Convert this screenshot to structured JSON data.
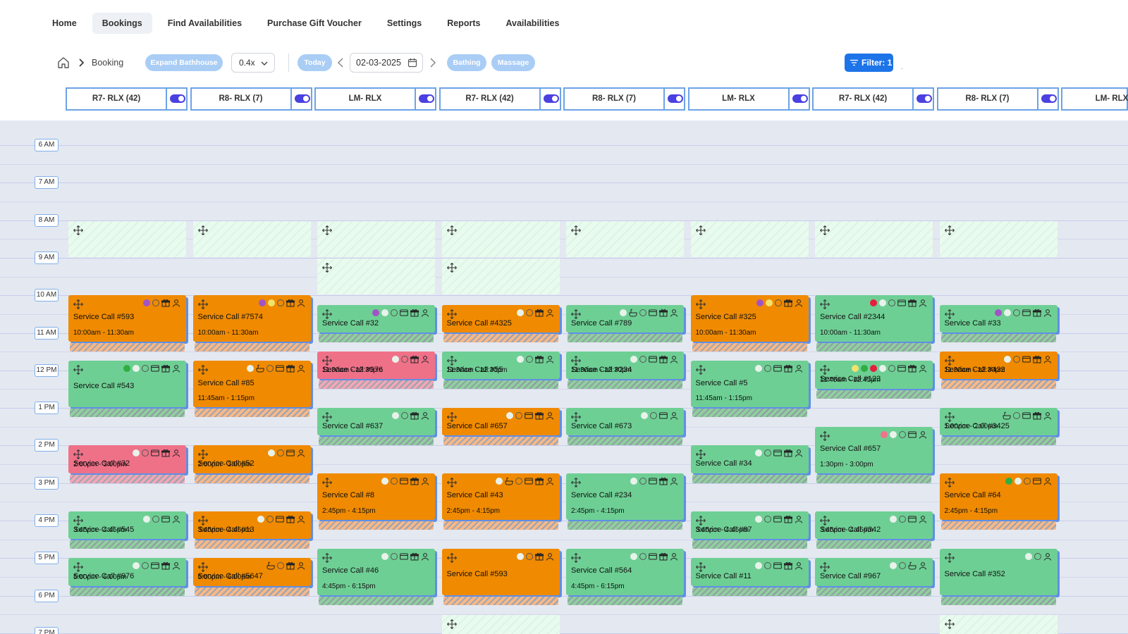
{
  "nav": {
    "items": [
      {
        "label": "Home",
        "active": false
      },
      {
        "label": "Bookings",
        "active": true
      },
      {
        "label": "Find Availabilities",
        "active": false
      },
      {
        "label": "Purchase Gift Voucher",
        "active": false
      },
      {
        "label": "Settings",
        "active": false
      },
      {
        "label": "Reports",
        "active": false
      },
      {
        "label": "Availabilities",
        "active": false
      }
    ]
  },
  "toolbar": {
    "breadcrumb_label": "Booking",
    "expand_label": "Expand Bathhouse",
    "zoom_value": "0.4x",
    "today_label": "Today",
    "date_value": "02-03-2025",
    "bathing_label": "Bathing",
    "massage_label": "Massage",
    "filter_label": "Filter: 1",
    "dot_mark": "."
  },
  "columns": [
    {
      "title": "R7- RLX (42)"
    },
    {
      "title": "R8- RLX (7)"
    },
    {
      "title": "LM- RLX"
    },
    {
      "title": "R7- RLX (42)"
    },
    {
      "title": "R8- RLX (7)"
    },
    {
      "title": "LM- RLX"
    },
    {
      "title": "R7- RLX (42)"
    },
    {
      "title": "R8- RLX (7)"
    },
    {
      "title": "LM- RLX"
    }
  ],
  "time_labels": [
    "6 AM",
    "7 AM",
    "8 AM",
    "9 AM",
    "10 AM",
    "11 AM",
    "12 PM",
    "1 PM",
    "2 PM",
    "3 PM",
    "4 PM",
    "5 PM",
    "6 PM",
    "7 PM"
  ],
  "colors": {
    "orange": "#f08a00",
    "green": "#6ecf94",
    "pink": "#ef7188",
    "accent": "#1d74e8"
  },
  "open_slots": [
    {
      "col": 0,
      "start": 8,
      "end": 9
    },
    {
      "col": 1,
      "start": 8,
      "end": 9
    },
    {
      "col": 2,
      "start": 8,
      "end": 9
    },
    {
      "col": 2,
      "start": 9,
      "end": 10
    },
    {
      "col": 3,
      "start": 8,
      "end": 9
    },
    {
      "col": 3,
      "start": 9,
      "end": 10
    },
    {
      "col": 4,
      "start": 8,
      "end": 9
    },
    {
      "col": 5,
      "start": 8,
      "end": 9
    },
    {
      "col": 6,
      "start": 8,
      "end": 9
    },
    {
      "col": 7,
      "start": 8,
      "end": 9
    },
    {
      "col": 3,
      "start": 18.5,
      "end": 19.5
    },
    {
      "col": 7,
      "start": 18.5,
      "end": 19.5
    }
  ],
  "bookings": [
    {
      "col": 0,
      "start": 10,
      "end": 11.5,
      "color": "orange",
      "title": "Service Call #593",
      "time": "10:00am - 11:30am",
      "icons": [
        "dot-purple",
        "ring",
        "gift",
        "user"
      ]
    },
    {
      "col": 0,
      "start": 11.75,
      "end": 13.25,
      "color": "green",
      "title": "Service Call #543",
      "time": "",
      "icons": [
        "dot-green",
        "dot-white",
        "ring",
        "card",
        "gift",
        "user"
      ]
    },
    {
      "col": 0,
      "start": 14,
      "end": 15,
      "color": "pink",
      "title": "Service Call #32",
      "time": "2:00pm - 3:00pm",
      "icons": [
        "dot-white",
        "ring",
        "card",
        "gift",
        "user"
      ]
    },
    {
      "col": 0,
      "start": 15.75,
      "end": 16.75,
      "color": "green",
      "title": "Service Call #545",
      "time": "3:45pm - 4:45pm",
      "icons": [
        "dot-white",
        "ring",
        "card",
        "user"
      ]
    },
    {
      "col": 0,
      "start": 17,
      "end": 18,
      "color": "green",
      "title": "Service Call #976",
      "time": "5:00pm - 6:00pm",
      "icons": [
        "dot-white",
        "ring",
        "card",
        "gift",
        "user"
      ]
    },
    {
      "col": 1,
      "start": 10,
      "end": 11.5,
      "color": "orange",
      "title": "Service Call #7574",
      "time": "10:00am - 11:30am",
      "icons": [
        "dot-purple",
        "dot-yellow",
        "ring",
        "gift",
        "user"
      ]
    },
    {
      "col": 1,
      "start": 11.75,
      "end": 13.25,
      "color": "orange",
      "title": "Service Call #85",
      "time": "11:45am - 1:15pm",
      "icons": [
        "dot-white",
        "bath",
        "ring",
        "card",
        "gift",
        "user"
      ]
    },
    {
      "col": 1,
      "start": 14,
      "end": 15,
      "color": "orange",
      "title": "Service Call #52",
      "time": "2:00pm - 3:00pm",
      "icons": [
        "dot-white",
        "ring",
        "card",
        "user"
      ]
    },
    {
      "col": 1,
      "start": 15.75,
      "end": 16.75,
      "color": "orange",
      "title": "Service Call #13",
      "time": "3:45pm - 4:45pm",
      "icons": [
        "dot-white",
        "ring",
        "card",
        "gift",
        "user"
      ]
    },
    {
      "col": 1,
      "start": 17,
      "end": 18,
      "color": "orange",
      "title": "Service Call #5647",
      "time": "5:00pm - 6:00pm",
      "icons": [
        "bath",
        "ring",
        "gift",
        "user"
      ]
    },
    {
      "col": 2,
      "start": 10.25,
      "end": 11.25,
      "color": "green",
      "title": "Service Call #32",
      "time": "",
      "icons": [
        "dot-purple",
        "dot-white",
        "ring",
        "card",
        "gift",
        "user"
      ]
    },
    {
      "col": 2,
      "start": 11.5,
      "end": 12.5,
      "color": "pink",
      "title": "Service Call #976",
      "time": "11:30am - 12:30pm",
      "icons": [
        "dot-white",
        "ring",
        "gift",
        "user"
      ]
    },
    {
      "col": 2,
      "start": 13,
      "end": 14,
      "color": "green",
      "title": "Service Call #637",
      "time": "",
      "icons": [
        "dot-white",
        "ring",
        "gift",
        "user"
      ]
    },
    {
      "col": 2,
      "start": 14.75,
      "end": 16.25,
      "color": "orange",
      "title": "Service Call #8",
      "time": "2:45pm - 4:15pm",
      "icons": [
        "dot-white",
        "ring",
        "card",
        "gift",
        "user"
      ]
    },
    {
      "col": 2,
      "start": 16.75,
      "end": 18.25,
      "color": "green",
      "title": "Service Call #46",
      "time": "4:45pm - 6:15pm",
      "icons": [
        "dot-white",
        "ring",
        "card",
        "gift",
        "user"
      ]
    },
    {
      "col": 3,
      "start": 10.25,
      "end": 11.25,
      "color": "orange",
      "title": "Service Call #4325",
      "time": "",
      "icons": [
        "dot-white",
        "ring",
        "gift",
        "user"
      ]
    },
    {
      "col": 3,
      "start": 11.5,
      "end": 12.5,
      "color": "green",
      "title": "Service Call #55",
      "time": "11:30am - 12:30pm",
      "icons": [
        "dot-white",
        "ring",
        "gift",
        "user"
      ]
    },
    {
      "col": 3,
      "start": 13,
      "end": 14,
      "color": "orange",
      "title": "Service Call #657",
      "time": "",
      "icons": [
        "dot-white",
        "ring",
        "card",
        "gift",
        "user"
      ]
    },
    {
      "col": 3,
      "start": 14.75,
      "end": 16.25,
      "color": "orange",
      "title": "Service Call #43",
      "time": "2:45pm - 4:15pm",
      "icons": [
        "dot-white",
        "bath",
        "ring",
        "card",
        "gift",
        "user"
      ]
    },
    {
      "col": 3,
      "start": 16.75,
      "end": 18.25,
      "color": "orange",
      "title": "Service Call #593",
      "time": "",
      "icons": [
        "dot-white",
        "ring",
        "gift",
        "user"
      ]
    },
    {
      "col": 4,
      "start": 10.25,
      "end": 11.25,
      "color": "green",
      "title": "Service Call #789",
      "time": "",
      "icons": [
        "dot-white",
        "bath",
        "ring",
        "card",
        "gift",
        "user"
      ]
    },
    {
      "col": 4,
      "start": 11.5,
      "end": 12.5,
      "color": "green",
      "title": "Service Call #234",
      "time": "11:30am - 12:30pm",
      "icons": [
        "dot-white",
        "ring",
        "card",
        "gift",
        "user"
      ]
    },
    {
      "col": 4,
      "start": 13,
      "end": 14,
      "color": "green",
      "title": "Service Call #673",
      "time": "",
      "icons": [
        "dot-white",
        "ring",
        "card",
        "user"
      ]
    },
    {
      "col": 4,
      "start": 14.75,
      "end": 16.25,
      "color": "green",
      "title": "Service Call #234",
      "time": "2:45pm - 4:15pm",
      "icons": [
        "dot-white",
        "ring",
        "card",
        "gift",
        "user"
      ]
    },
    {
      "col": 4,
      "start": 16.75,
      "end": 18.25,
      "color": "green",
      "title": "Service Call #564",
      "time": "4:45pm - 6:15pm",
      "icons": [
        "dot-white",
        "ring",
        "card",
        "gift",
        "user"
      ]
    },
    {
      "col": 5,
      "start": 10,
      "end": 11.5,
      "color": "orange",
      "title": "Service Call #325",
      "time": "10:00am - 11:30am",
      "icons": [
        "dot-purple",
        "dot-yellow",
        "ring",
        "gift",
        "user"
      ]
    },
    {
      "col": 5,
      "start": 11.75,
      "end": 13.25,
      "color": "green",
      "title": "Service Call #5",
      "time": "11:45am - 1:15pm",
      "icons": [
        "dot-white",
        "ring",
        "card",
        "gift",
        "user"
      ]
    },
    {
      "col": 5,
      "start": 14,
      "end": 15,
      "color": "green",
      "title": "Service Call #34",
      "time": "",
      "icons": [
        "dot-white",
        "ring",
        "card",
        "gift",
        "user"
      ]
    },
    {
      "col": 5,
      "start": 15.75,
      "end": 16.75,
      "color": "green",
      "title": "Service Call #87",
      "time": "3:45pm - 4:45pm",
      "icons": [
        "dot-white",
        "ring",
        "card",
        "gift",
        "user"
      ]
    },
    {
      "col": 5,
      "start": 17,
      "end": 18,
      "color": "green",
      "title": "Service Call #11",
      "time": "",
      "icons": [
        "dot-white",
        "ring",
        "card",
        "gift",
        "user"
      ]
    },
    {
      "col": 6,
      "start": 10,
      "end": 11.5,
      "color": "green",
      "title": "Service Call #2344",
      "time": "10:00am - 11:30am",
      "icons": [
        "dot-red",
        "dot-white",
        "ring",
        "card",
        "gift",
        "user"
      ]
    },
    {
      "col": 6,
      "start": 11.75,
      "end": 12.75,
      "color": "green",
      "title": "Service Call #123",
      "time": "11:45am - 12:45pm",
      "icons": [
        "dot-yellow",
        "dot-green",
        "dot-red",
        "dot-white",
        "ring",
        "card",
        "gift",
        "user"
      ]
    },
    {
      "col": 6,
      "start": 13.5,
      "end": 15,
      "color": "green",
      "title": "Service Call #657",
      "time": "1:30pm - 3:00pm",
      "icons": [
        "dot-pink",
        "dot-white",
        "ring",
        "card",
        "user"
      ]
    },
    {
      "col": 6,
      "start": 15.75,
      "end": 16.75,
      "color": "green",
      "title": "Service Call #342",
      "time": "3:45pm - 4:45pm",
      "icons": [
        "dot-white",
        "ring",
        "card",
        "user"
      ]
    },
    {
      "col": 6,
      "start": 17,
      "end": 18,
      "color": "green",
      "title": "Service Call #967",
      "time": "",
      "icons": [
        "dot-white",
        "ring",
        "bath",
        "user"
      ]
    },
    {
      "col": 7,
      "start": 10.25,
      "end": 11.25,
      "color": "green",
      "title": "Service Call #33",
      "time": "",
      "icons": [
        "dot-purple",
        "dot-white",
        "ring",
        "card",
        "gift",
        "user"
      ]
    },
    {
      "col": 7,
      "start": 11.5,
      "end": 12.5,
      "color": "orange",
      "title": "Service Call #432",
      "time": "11:30am - 12:30pm",
      "icons": [
        "dot-white",
        "ring",
        "card",
        "gift",
        "user"
      ]
    },
    {
      "col": 7,
      "start": 13,
      "end": 14,
      "color": "green",
      "title": "Service Call #3425",
      "time": "1:00pm - 2:00pm",
      "icons": [
        "bath",
        "ring",
        "card",
        "gift",
        "user"
      ]
    },
    {
      "col": 7,
      "start": 14.75,
      "end": 16.25,
      "color": "orange",
      "title": "Service Call #64",
      "time": "2:45pm - 4:15pm",
      "icons": [
        "dot-green",
        "dot-white",
        "ring",
        "card",
        "user"
      ]
    },
    {
      "col": 7,
      "start": 16.75,
      "end": 18.25,
      "color": "green",
      "title": "Service Call #352",
      "time": "",
      "icons": [
        "dot-white",
        "ring",
        "user"
      ]
    }
  ]
}
